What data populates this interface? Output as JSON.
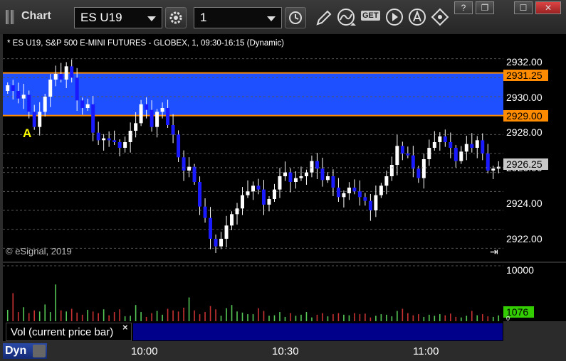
{
  "toolbar": {
    "title": "Chart",
    "symbol": "ES U19",
    "interval": "1",
    "get_label": "GET"
  },
  "window": {
    "help": "?",
    "restore": "❐",
    "maximize": "☐",
    "close": "✕"
  },
  "chart": {
    "header": "* ES U19, S&P 500 E-MINI FUTURES - GLOBEX, 1, 09:30-16:15 (Dynamic)",
    "copyright": "© eSignal, 2019",
    "marker": "A",
    "autoscroll_glyph": "⇥",
    "colors": {
      "background": "#000000",
      "zone_fill": "#1e50ff",
      "zone_line": "#ff8c00",
      "up": "#ffffff",
      "down": "#1a1aff",
      "vol_up": "#55c855",
      "vol_down": "#c83232"
    }
  },
  "price_axis": {
    "ticks": [
      "2932.00",
      "2930.00",
      "2928.00",
      "2926.00",
      "2924.00",
      "2922.00"
    ],
    "zone_high": "2931.25",
    "zone_low": "2929.00",
    "last_price": "2926.25"
  },
  "volume": {
    "label": "Vol (current price bar)",
    "close": "×",
    "axis_top": "10000",
    "axis_zero": "0",
    "last": "1076"
  },
  "time_axis": {
    "labels": [
      "10:00",
      "10:30",
      "11:00"
    ],
    "dyn_label": "Dyn"
  },
  "chart_data": {
    "type": "candlestick",
    "price_range": [
      2921.3,
      2933.3
    ],
    "zone": [
      2929.0,
      2931.25
    ],
    "last_price": 2926.25,
    "x_labels": [
      "10:00",
      "10:30",
      "11:00"
    ],
    "closes": [
      2930.6,
      2930.3,
      2929.9,
      2930.1,
      2929.2,
      2928.4,
      2929.2,
      2930.0,
      2930.9,
      2931.2,
      2930.9,
      2931.6,
      2931.0,
      2929.8,
      2929.4,
      2929.6,
      2928.1,
      2927.7,
      2927.8,
      2927.7,
      2927.6,
      2927.3,
      2927.6,
      2928.2,
      2928.6,
      2929.6,
      2929.3,
      2928.4,
      2929.2,
      2929.4,
      2928.5,
      2928.0,
      2926.8,
      2926.1,
      2926.3,
      2925.5,
      2924.2,
      2923.6,
      2922.5,
      2922.1,
      2922.5,
      2923.2,
      2923.8,
      2924.1,
      2924.8,
      2925.0,
      2925.3,
      2925.1,
      2924.3,
      2924.6,
      2925.1,
      2925.8,
      2926.0,
      2925.5,
      2925.7,
      2925.8,
      2926.0,
      2926.6,
      2926.2,
      2925.6,
      2925.8,
      2925.2,
      2924.7,
      2924.9,
      2925.2,
      2925.0,
      2924.7,
      2924.5,
      2924.0,
      2924.8,
      2925.3,
      2925.8,
      2926.4,
      2927.4,
      2927.0,
      2926.9,
      2926.2,
      2925.7,
      2926.7,
      2927.3,
      2927.6,
      2927.9,
      2927.6,
      2927.3,
      2926.6,
      2927.1,
      2927.5,
      2927.3,
      2927.7,
      2927.0,
      2926.1,
      2926.2,
      2926.3
    ],
    "volume": [
      2100,
      5200,
      1700,
      2600,
      1500,
      2000,
      1800,
      3100,
      1700,
      6800,
      2000,
      1800,
      2300,
      1600,
      1200,
      2100,
      1800,
      1500,
      2200,
      1100,
      1700,
      2200,
      900,
      1000,
      3000,
      1700,
      800,
      1500,
      1900,
      1200,
      2300,
      2000,
      1800,
      2500,
      4400,
      2000,
      1300,
      1700,
      2800,
      2200,
      1000,
      2400,
      3000,
      1800,
      1600,
      1300,
      1300,
      2400,
      1900,
      1000,
      1100,
      1700,
      800,
      1500,
      1000,
      1200,
      1700,
      700,
      1200,
      1500,
      900,
      1300,
      1500,
      1200,
      1100,
      1500,
      1300,
      1400,
      700,
      1000,
      1300,
      1200,
      900,
      1900,
      2300,
      1500,
      1100,
      1300,
      800,
      1200,
      1000,
      1300,
      1100,
      1400,
      800,
      700,
      1000,
      1900,
      1100,
      1300,
      900,
      800,
      1076
    ],
    "volume_range": [
      0,
      10000
    ]
  }
}
